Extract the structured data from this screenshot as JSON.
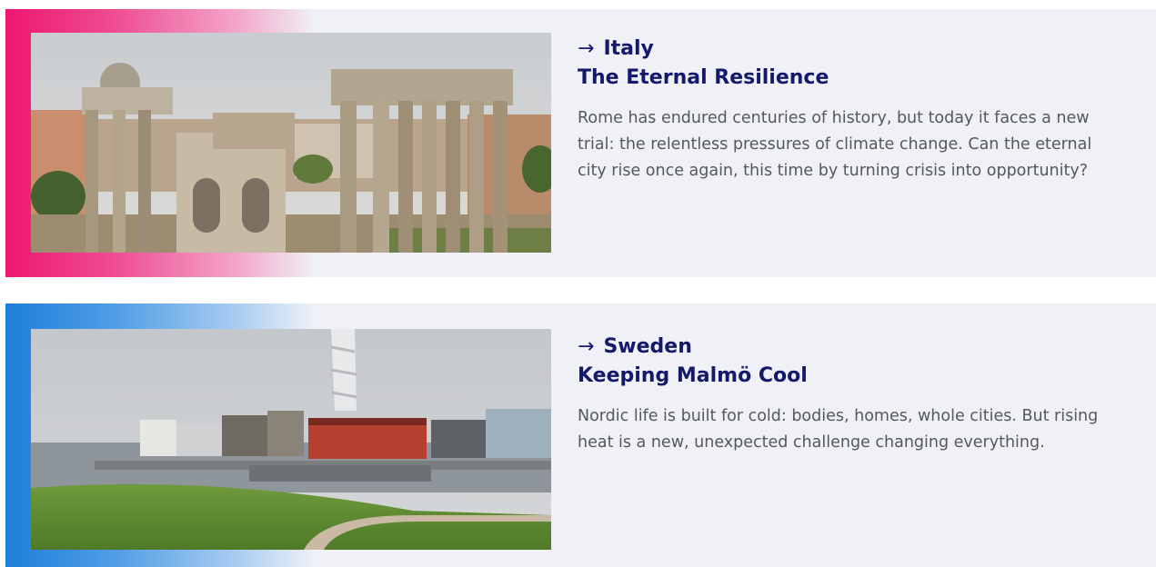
{
  "articles": [
    {
      "country": "Italy",
      "title": "The Eternal Resilience",
      "description": "Rome has endured centuries of history, but today it faces a new trial: the relentless pressures of climate change. Can the eternal city rise once again, this time by turning crisis into opportunity?",
      "arrow": "→",
      "accent_color": "#ee1670",
      "image": "roman-forum-ruins-photo"
    },
    {
      "country": "Sweden",
      "title": "Keeping Malmö Cool",
      "description": "Nordic life is built for cold: bodies, homes, whole cities. But rising heat is a new, unexpected challenge changing everything.",
      "arrow": "→",
      "accent_color": "#1e7fda",
      "image": "malmo-waterfront-photo"
    }
  ],
  "colors": {
    "heading": "#14196b",
    "body_text": "#55585f",
    "card_bg": "#eff1f6"
  }
}
